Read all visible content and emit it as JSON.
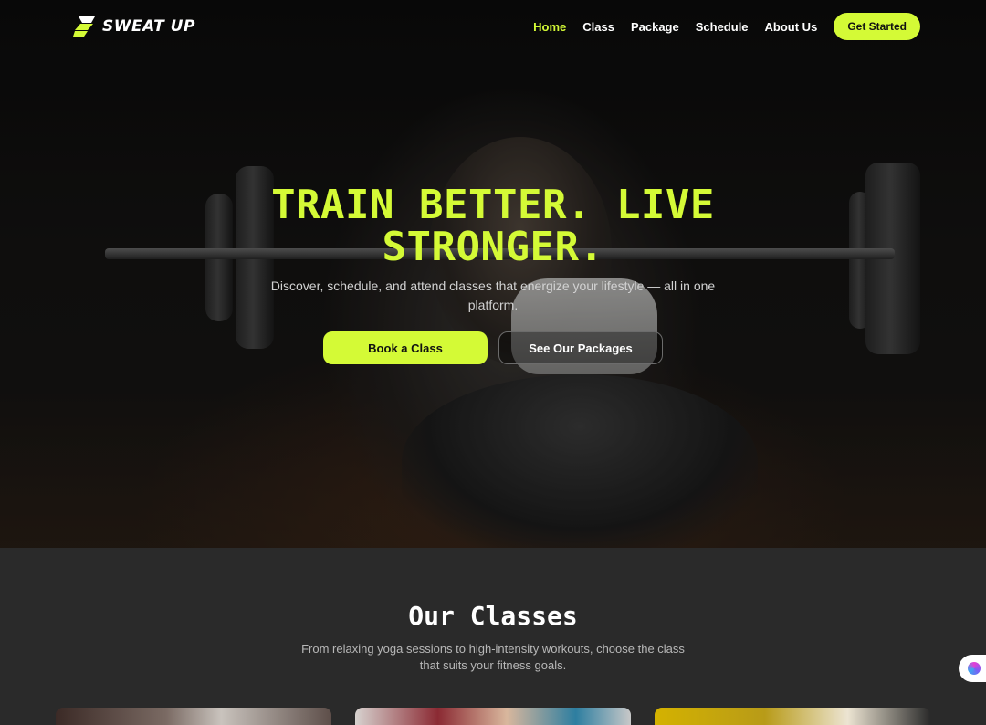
{
  "brand": {
    "name": "SWEAT UP",
    "accent_color": "#d4fa36"
  },
  "nav": {
    "links": [
      {
        "label": "Home",
        "active": true
      },
      {
        "label": "Class",
        "active": false
      },
      {
        "label": "Package",
        "active": false
      },
      {
        "label": "Schedule",
        "active": false
      },
      {
        "label": "About Us",
        "active": false
      }
    ],
    "cta_label": "Get Started"
  },
  "hero": {
    "title_line1": "TRAIN BETTER. LIVE",
    "title_line2": "STRONGER.",
    "subtitle": "Discover, schedule, and attend classes that energize your lifestyle — all in one platform.",
    "primary_button": "Book a Class",
    "secondary_button": "See Our Packages"
  },
  "classes": {
    "title": "Our Classes",
    "subtitle": "From relaxing yoga sessions to high-intensity workouts, choose the class that suits your fitness goals."
  },
  "widget": {
    "icon": "assistant-icon"
  }
}
